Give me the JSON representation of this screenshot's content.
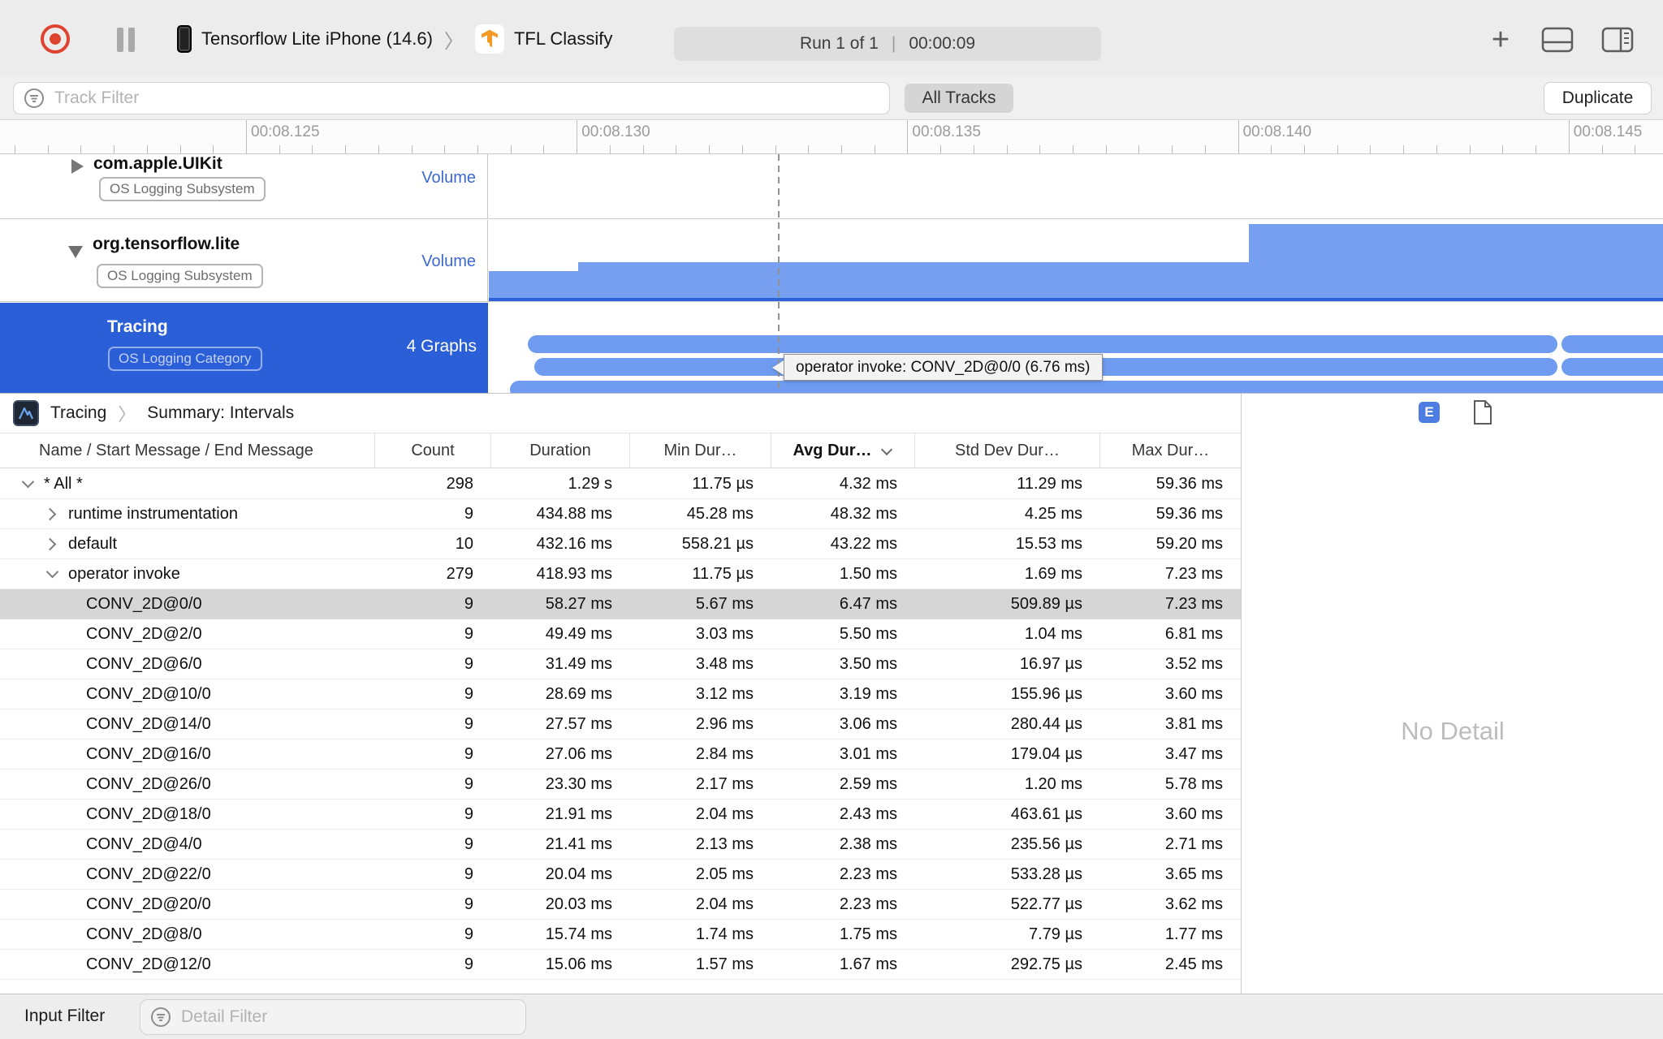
{
  "toolbar": {
    "device": "Tensorflow Lite iPhone (14.6)",
    "target": "TFL Classify",
    "run_label": "Run 1 of 1",
    "separator": "|",
    "run_time": "00:00:09"
  },
  "filter_bar": {
    "track_filter_placeholder": "Track Filter",
    "all_tracks_label": "All Tracks",
    "duplicate_label": "Duplicate"
  },
  "ruler": {
    "ticks": [
      "00:08.125",
      "00:08.130",
      "00:08.135",
      "00:08.140",
      "00:08.145"
    ]
  },
  "tracks": [
    {
      "title": "com.apple.UIKit",
      "badge": "OS Logging Subsystem",
      "lane_label": "Volume",
      "disclosure": "collapsed",
      "selected": false
    },
    {
      "title": "org.tensorflow.lite",
      "badge": "OS Logging Subsystem",
      "lane_label": "Volume",
      "disclosure": "expanded",
      "selected": false
    },
    {
      "title": "Tracing",
      "badge": "OS Logging Category",
      "lane_label": "4 Graphs",
      "disclosure": "none",
      "selected": true
    }
  ],
  "tooltip": "operator invoke: CONV_2D@0/0 (6.76 ms)",
  "detail": {
    "breadcrumb": {
      "root": "Tracing",
      "page": "Summary: Intervals"
    },
    "columns": [
      "Name / Start Message / End Message",
      "Count",
      "Duration",
      "Min Dur…",
      "Avg Dur…",
      "Std Dev Dur…",
      "Max Dur…"
    ],
    "sorted_column": "Avg Dur…",
    "no_detail": "No Detail",
    "rows": [
      {
        "indent": 0,
        "disclosure": "down",
        "name": "* All *",
        "count": "298",
        "duration": "1.29 s",
        "min": "11.75 µs",
        "avg": "4.32 ms",
        "std": "11.29 ms",
        "max": "59.36 ms",
        "selected": false
      },
      {
        "indent": 1,
        "disclosure": "right",
        "name": "runtime instrumentation",
        "count": "9",
        "duration": "434.88 ms",
        "min": "45.28 ms",
        "avg": "48.32 ms",
        "std": "4.25 ms",
        "max": "59.36 ms",
        "selected": false
      },
      {
        "indent": 1,
        "disclosure": "right",
        "name": "default",
        "count": "10",
        "duration": "432.16 ms",
        "min": "558.21 µs",
        "avg": "43.22 ms",
        "std": "15.53 ms",
        "max": "59.20 ms",
        "selected": false
      },
      {
        "indent": 1,
        "disclosure": "down",
        "name": "operator invoke",
        "count": "279",
        "duration": "418.93 ms",
        "min": "11.75 µs",
        "avg": "1.50 ms",
        "std": "1.69 ms",
        "max": "7.23 ms",
        "selected": false
      },
      {
        "indent": 2,
        "disclosure": "none",
        "name": "CONV_2D@0/0",
        "count": "9",
        "duration": "58.27 ms",
        "min": "5.67 ms",
        "avg": "6.47 ms",
        "std": "509.89 µs",
        "max": "7.23 ms",
        "selected": true
      },
      {
        "indent": 2,
        "disclosure": "none",
        "name": "CONV_2D@2/0",
        "count": "9",
        "duration": "49.49 ms",
        "min": "3.03 ms",
        "avg": "5.50 ms",
        "std": "1.04 ms",
        "max": "6.81 ms",
        "selected": false
      },
      {
        "indent": 2,
        "disclosure": "none",
        "name": "CONV_2D@6/0",
        "count": "9",
        "duration": "31.49 ms",
        "min": "3.48 ms",
        "avg": "3.50 ms",
        "std": "16.97 µs",
        "max": "3.52 ms",
        "selected": false
      },
      {
        "indent": 2,
        "disclosure": "none",
        "name": "CONV_2D@10/0",
        "count": "9",
        "duration": "28.69 ms",
        "min": "3.12 ms",
        "avg": "3.19 ms",
        "std": "155.96 µs",
        "max": "3.60 ms",
        "selected": false
      },
      {
        "indent": 2,
        "disclosure": "none",
        "name": "CONV_2D@14/0",
        "count": "9",
        "duration": "27.57 ms",
        "min": "2.96 ms",
        "avg": "3.06 ms",
        "std": "280.44 µs",
        "max": "3.81 ms",
        "selected": false
      },
      {
        "indent": 2,
        "disclosure": "none",
        "name": "CONV_2D@16/0",
        "count": "9",
        "duration": "27.06 ms",
        "min": "2.84 ms",
        "avg": "3.01 ms",
        "std": "179.04 µs",
        "max": "3.47 ms",
        "selected": false
      },
      {
        "indent": 2,
        "disclosure": "none",
        "name": "CONV_2D@26/0",
        "count": "9",
        "duration": "23.30 ms",
        "min": "2.17 ms",
        "avg": "2.59 ms",
        "std": "1.20 ms",
        "max": "5.78 ms",
        "selected": false
      },
      {
        "indent": 2,
        "disclosure": "none",
        "name": "CONV_2D@18/0",
        "count": "9",
        "duration": "21.91 ms",
        "min": "2.04 ms",
        "avg": "2.43 ms",
        "std": "463.61 µs",
        "max": "3.60 ms",
        "selected": false
      },
      {
        "indent": 2,
        "disclosure": "none",
        "name": "CONV_2D@4/0",
        "count": "9",
        "duration": "21.41 ms",
        "min": "2.13 ms",
        "avg": "2.38 ms",
        "std": "235.56 µs",
        "max": "2.71 ms",
        "selected": false
      },
      {
        "indent": 2,
        "disclosure": "none",
        "name": "CONV_2D@22/0",
        "count": "9",
        "duration": "20.04 ms",
        "min": "2.05 ms",
        "avg": "2.23 ms",
        "std": "533.28 µs",
        "max": "3.65 ms",
        "selected": false
      },
      {
        "indent": 2,
        "disclosure": "none",
        "name": "CONV_2D@20/0",
        "count": "9",
        "duration": "20.03 ms",
        "min": "2.04 ms",
        "avg": "2.23 ms",
        "std": "522.77 µs",
        "max": "3.62 ms",
        "selected": false
      },
      {
        "indent": 2,
        "disclosure": "none",
        "name": "CONV_2D@8/0",
        "count": "9",
        "duration": "15.74 ms",
        "min": "1.74 ms",
        "avg": "1.75 ms",
        "std": "7.79 µs",
        "max": "1.77 ms",
        "selected": false
      },
      {
        "indent": 2,
        "disclosure": "none",
        "name": "CONV_2D@12/0",
        "count": "9",
        "duration": "15.06 ms",
        "min": "1.57 ms",
        "avg": "1.67 ms",
        "std": "292.75 µs",
        "max": "2.45 ms",
        "selected": false
      }
    ]
  },
  "bottom_bar": {
    "label": "Input Filter",
    "placeholder": "Detail Filter"
  },
  "colors": {
    "accent_blue": "#2b5fd8",
    "interval_blue": "#6f9cf0",
    "record_red": "#df4431"
  }
}
